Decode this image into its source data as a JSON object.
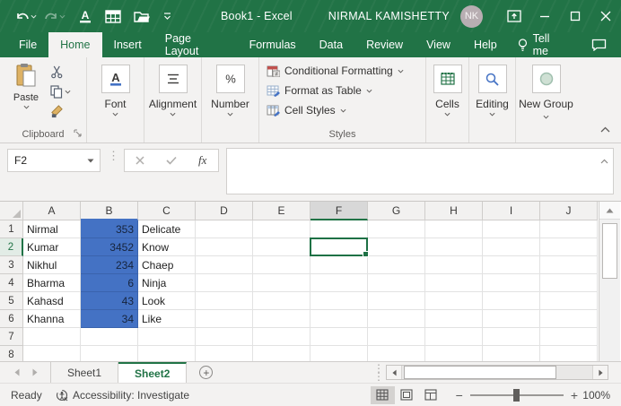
{
  "colors": {
    "excel_green": "#217346",
    "selection_blue": "#4472C4",
    "ribbon_bg": "#f3f2f1"
  },
  "titlebar": {
    "title": "Book1 - Excel",
    "account_name": "NIRMAL KAMISHETTY",
    "avatar_initials": "NK"
  },
  "menubar": {
    "tabs": [
      "File",
      "Home",
      "Insert",
      "Page Layout",
      "Formulas",
      "Data",
      "Review",
      "View",
      "Help"
    ],
    "active_tab": "Home",
    "tell_me": "Tell me"
  },
  "ribbon": {
    "paste_label": "Paste",
    "clipboard_label": "Clipboard",
    "collapsed_groups": [
      "Font",
      "Alignment",
      "Number"
    ],
    "styles": {
      "items": [
        "Conditional Formatting",
        "Format as Table",
        "Cell Styles"
      ],
      "label": "Styles"
    },
    "cells_label": "Cells",
    "editing_label": "Editing",
    "new_group_label": "New Group"
  },
  "formula_bar": {
    "name_box": "F2",
    "fx_label": "fx",
    "value": ""
  },
  "grid": {
    "columns": [
      "A",
      "B",
      "C",
      "D",
      "E",
      "F",
      "G",
      "H",
      "I",
      "J"
    ],
    "active_cell": "F2",
    "active_column": "F",
    "active_row": 2,
    "filled_column": "B",
    "fill_color": "#4472C4",
    "rows": [
      {
        "n": "1",
        "A": "Nirmal",
        "B": "353",
        "C": "Delicate"
      },
      {
        "n": "2",
        "A": "Kumar",
        "B": "3452",
        "C": "Know"
      },
      {
        "n": "3",
        "A": "Nikhul",
        "B": "234",
        "C": "Chaep"
      },
      {
        "n": "4",
        "A": "Bharma",
        "B": "6",
        "C": "Ninja"
      },
      {
        "n": "5",
        "A": "Kahasd",
        "B": "43",
        "C": "Look"
      },
      {
        "n": "6",
        "A": "Khanna",
        "B": "34",
        "C": "Like"
      },
      {
        "n": "7"
      },
      {
        "n": "8"
      }
    ]
  },
  "sheet_bar": {
    "tabs": [
      {
        "label": "Sheet1",
        "active": false
      },
      {
        "label": "Sheet2",
        "active": true
      }
    ]
  },
  "status_bar": {
    "mode": "Ready",
    "accessibility": "Accessibility: Investigate",
    "zoom": "100%"
  }
}
